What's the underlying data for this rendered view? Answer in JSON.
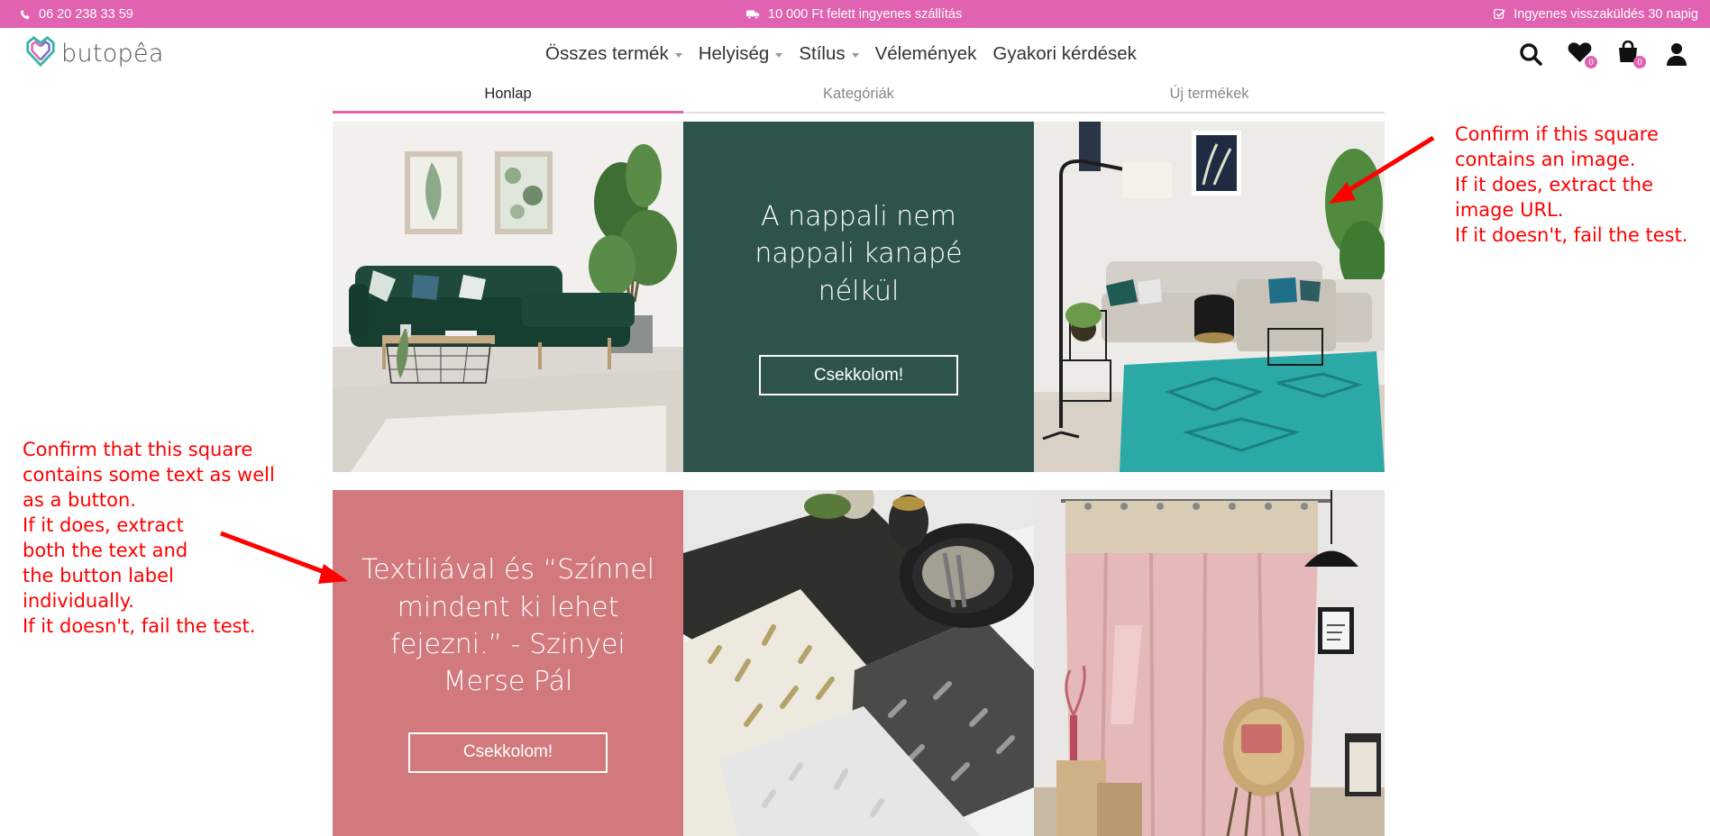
{
  "topbar": {
    "phone": "06 20 238 33 59",
    "shipping": "10 000 Ft felett ingyenes szállítás",
    "returns": "Ingyenes visszaküldés 30 napig"
  },
  "header": {
    "logo_text": "butopêa",
    "nav": [
      {
        "label": "Összes termék",
        "has_dropdown": true
      },
      {
        "label": "Helyiség",
        "has_dropdown": true
      },
      {
        "label": "Stílus",
        "has_dropdown": true
      },
      {
        "label": "Vélemények",
        "has_dropdown": false
      },
      {
        "label": "Gyakori kérdések",
        "has_dropdown": false
      }
    ],
    "wishlist_count": "0",
    "cart_count": "0",
    "icons": [
      "search-icon",
      "heart-icon",
      "shopping-bag-icon",
      "user-icon"
    ]
  },
  "tabs": [
    {
      "label": "Honlap",
      "active": true
    },
    {
      "label": "Kategóriák",
      "active": false
    },
    {
      "label": "Új termékek",
      "active": false
    }
  ],
  "tiles": {
    "living_room_text": {
      "heading": "A nappali nem nappali kanapé nélkül",
      "button": "Csekkolom!",
      "bg": "#2e524c"
    },
    "textile_text": {
      "heading": "Textiliával és “Színnel mindent ki lehet fejezni.” - Szinyei Merse Pál",
      "button": "Csekkolom!",
      "bg": "#d1797d"
    }
  },
  "annotations": {
    "right": [
      "Confirm if this square",
      "contains an image.",
      "If it does, extract the",
      "image URL.",
      "If it doesn't, fail the test."
    ],
    "left": [
      "Confirm that this square",
      "contains some text as well",
      "as a button.",
      "If it does, extract",
      "both the text and",
      "the button label",
      "individually.",
      "If it doesn't, fail the test."
    ]
  },
  "colors": {
    "brand_pink": "#e062b1",
    "annotation_red": "#ff0000"
  }
}
